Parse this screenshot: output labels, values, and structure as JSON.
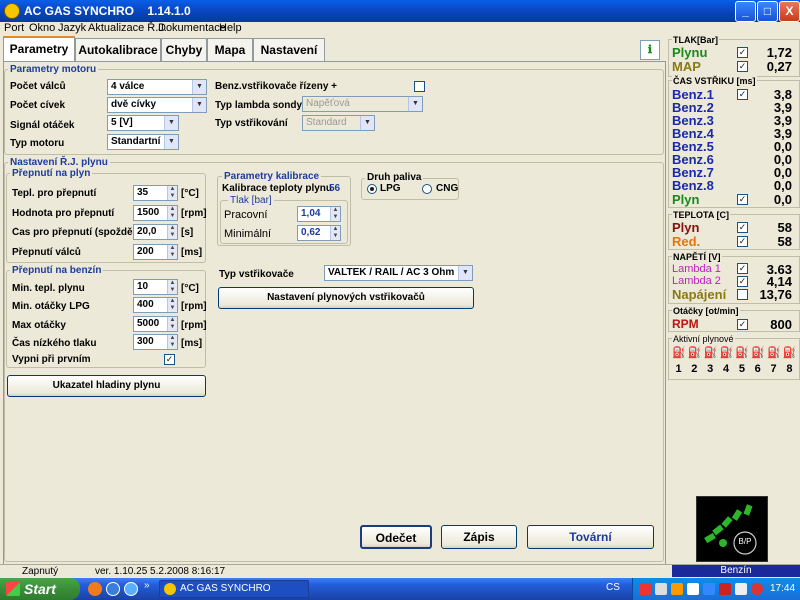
{
  "window": {
    "title": "AC GAS SYNCHRO",
    "version": "1.14.1.0",
    "min": "_",
    "max": "□",
    "close": "X"
  },
  "menu": [
    "Port",
    "Okno",
    "Jazyk",
    "Aktualizace Ř.J.",
    "Dokumentace",
    "Help"
  ],
  "tabs": [
    "Parametry",
    "Autokalibrace",
    "Chyby",
    "Mapa",
    "Nastavení"
  ],
  "parametry_motoru": {
    "title": "Parametry motoru",
    "pocet_valcu": {
      "label": "Počet válců",
      "value": "4 válce"
    },
    "pocet_civek": {
      "label": "Počet cívek",
      "value": "dvě cívky"
    },
    "signal_otacek": {
      "label": "Signál otáček",
      "value": "5 [V]"
    },
    "typ_motoru": {
      "label": "Typ motoru",
      "value": "Standartní"
    },
    "benz_vstrikovace": {
      "label": "Benz.vstřikovače řízeny  +",
      "checked": false
    },
    "typ_lambda": {
      "label": "Typ lambda sondy",
      "value": "Napěťová"
    },
    "typ_vstrikovani": {
      "label": "Typ vstřikování",
      "value": "Standard"
    }
  },
  "nastaveni_rj": {
    "title": "Nastavení Ř.J. plynu"
  },
  "prepnuti_na_plyn": {
    "title": "Přepnutí na plyn",
    "rows": [
      {
        "label": "Tepl. pro přepnutí",
        "value": "35",
        "unit": "[°C]"
      },
      {
        "label": "Hodnota pro přepnutí",
        "value": "1500",
        "unit": "[rpm]"
      },
      {
        "label": "Čas pro přepnutí (spoždění)",
        "value": "20,0",
        "unit": "[s]"
      },
      {
        "label": "Přepnutí válců",
        "value": "200",
        "unit": "[ms]"
      }
    ]
  },
  "prepnuti_na_benzin": {
    "title": "Přepnutí na benzín",
    "rows": [
      {
        "label": "Min. tepl. plynu",
        "value": "10",
        "unit": "[°C]"
      },
      {
        "label": "Min. otáčky LPG",
        "value": "400",
        "unit": "[rpm]"
      },
      {
        "label": "Max otáčky",
        "value": "5000",
        "unit": "[rpm]"
      },
      {
        "label": "Čas nízkého tlaku",
        "value": "300",
        "unit": "[ms]"
      }
    ],
    "vypni": {
      "label": "Vypni při prvním",
      "checked": true
    }
  },
  "ukazatel_button": "Ukazatel hladiny plynu",
  "parametry_kalibrace": {
    "title": "Parametry kalibrace",
    "kalibrace_teploty": {
      "label": "Kalibrace teploty plynu",
      "value": "56"
    },
    "tlak_title": "Tlak [bar]",
    "pracovni": {
      "label": "Pracovní",
      "value": "1,04"
    },
    "minimalni": {
      "label": "Minimální",
      "value": "0,62"
    }
  },
  "druh_paliva": {
    "title": "Druh paliva",
    "lpg": "LPG",
    "cng": "CNG",
    "selected": "LPG"
  },
  "typ_vstrikovace": {
    "label": "Typ vstřikovače",
    "value": "VALTEK / RAIL / AC 3 Ohm"
  },
  "nastaveni_vstrikovacu_button": "Nastavení plynových vstřikovačů",
  "bottom_buttons": {
    "odecet": "Odečet",
    "zapis": "Zápis",
    "tovarni": "Tovární"
  },
  "right_panel": {
    "tlak": {
      "title": "TLAK[Bar]",
      "rows": [
        {
          "name": "Plynu",
          "value": "1,72",
          "color": "#1a8a1a",
          "checked": true
        },
        {
          "name": "MAP",
          "value": "0,27",
          "color": "#8a7a10",
          "checked": true
        }
      ]
    },
    "cas_vstriku": {
      "title": "ČAS VSTŘIKU  [ms]",
      "rows": [
        {
          "name": "Benz.1",
          "value": "3,8",
          "color": "#1a2aa8",
          "checked": true
        },
        {
          "name": "Benz.2",
          "value": "3,9",
          "color": "#1a2aa8"
        },
        {
          "name": "Benz.3",
          "value": "3,9",
          "color": "#1a2aa8"
        },
        {
          "name": "Benz.4",
          "value": "3,9",
          "color": "#1a2aa8"
        },
        {
          "name": "Benz.5",
          "value": "0,0",
          "color": "#1a2aa8"
        },
        {
          "name": "Benz.6",
          "value": "0,0",
          "color": "#1a2aa8"
        },
        {
          "name": "Benz.7",
          "value": "0,0",
          "color": "#1a2aa8"
        },
        {
          "name": "Benz.8",
          "value": "0,0",
          "color": "#1a2aa8"
        },
        {
          "name": "Plyn",
          "value": "0,0",
          "color": "#1a8a1a",
          "checked": true
        }
      ]
    },
    "teplota": {
      "title": "TEPLOTA  [C]",
      "rows": [
        {
          "name": "Plyn",
          "value": "58",
          "color": "#8a1010",
          "checked": true
        },
        {
          "name": "Red.",
          "value": "58",
          "color": "#e07810",
          "checked": true
        }
      ]
    },
    "napeti": {
      "title": "NAPĚTÍ [V]",
      "rows": [
        {
          "name": "Lambda 1",
          "value": "3.63",
          "color": "#c020c0",
          "checked": true
        },
        {
          "name": "Lambda 2",
          "value": "4,14",
          "color": "#c020c0",
          "checked": true
        },
        {
          "name": "Napájení",
          "value": "13,76",
          "color": "#8a7a10",
          "checked": false
        }
      ]
    },
    "otacky": {
      "title": "Otáčky [ot/min]",
      "rows": [
        {
          "name": "RPM",
          "value": "800",
          "color": "#c01010",
          "checked": true
        }
      ]
    },
    "aktivni": {
      "title": "Aktivní plynové",
      "numbers": [
        "1",
        "2",
        "3",
        "4",
        "5",
        "6",
        "7",
        "8"
      ],
      "active_count": 4
    },
    "gauge_label": "B/P",
    "fuel_status": "Benzín"
  },
  "status_bar": {
    "state": "Zapnutý",
    "version": "ver. 1.10.25  5.2.2008  8:16:17"
  },
  "taskbar": {
    "start": "Start",
    "task": "AC GAS SYNCHRO",
    "lang": "CS",
    "clock": "17:44"
  }
}
